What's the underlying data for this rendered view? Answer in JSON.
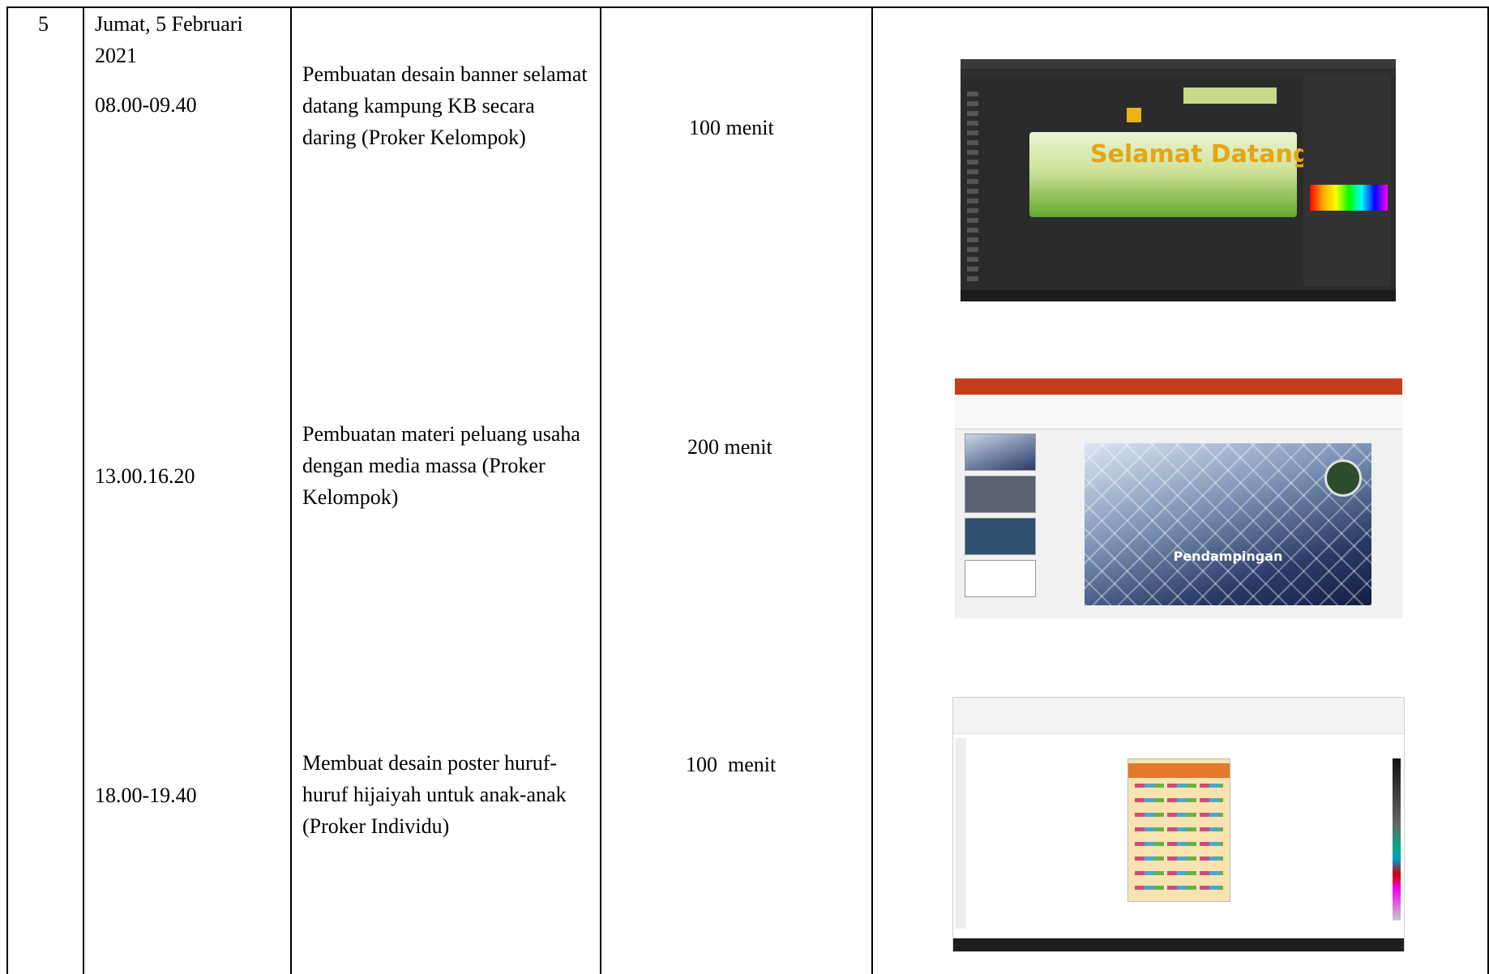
{
  "row": {
    "number": "5",
    "date": "Jumat, 5 Februari 2021",
    "entries": [
      {
        "time": "08.00-09.40",
        "activity": "Pembuatan desain banner selamat datang kampung KB secara daring (Proker Kelompok)",
        "duration": "100 menit",
        "evidence_text": "Selamat Datang"
      },
      {
        "time": "13.00.16.20",
        "activity": "Pembuatan materi peluang usaha dengan media massa (Proker Kelompok)",
        "duration": "200 menit",
        "evidence_text": "Pendampingan"
      },
      {
        "time": "18.00-19.40",
        "activity": "Membuat desain poster huruf-huruf hijaiyah untuk anak-anak (Proker Individu)",
        "duration": "100  menit"
      }
    ]
  }
}
